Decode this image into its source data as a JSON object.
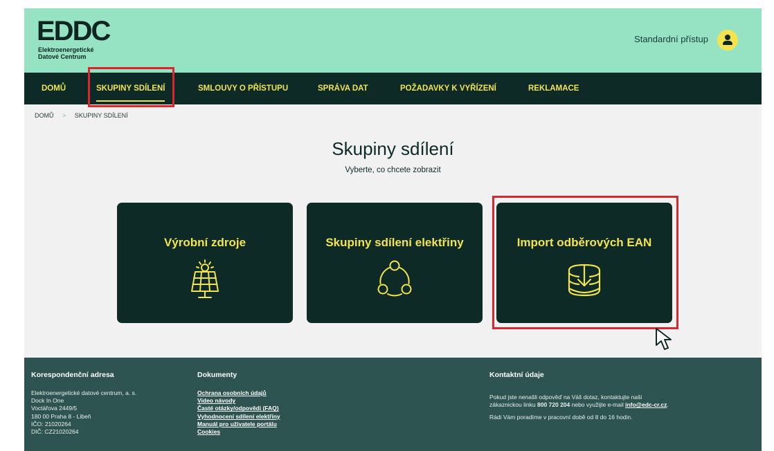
{
  "header": {
    "logo_mark": "EDDC",
    "logo_line1": "Elektroenergetické",
    "logo_line2": "Datové Centrum",
    "access_label": "Standardní přístup",
    "user_icon": "user-icon"
  },
  "nav": {
    "items": [
      {
        "label": "DOMŮ"
      },
      {
        "label": "SKUPINY SDÍLENÍ"
      },
      {
        "label": "SMLOUVY O PŘÍSTUPU"
      },
      {
        "label": "SPRÁVA DAT"
      },
      {
        "label": "POŽADAVKY K VYŘÍZENÍ"
      },
      {
        "label": "REKLAMACE"
      }
    ]
  },
  "breadcrumb": {
    "home": "DOMŮ",
    "separator": ">",
    "current": "SKUPINY SDÍLENÍ"
  },
  "page": {
    "title": "Skupiny sdílení",
    "subtitle": "Vyberte, co chcete zobrazit"
  },
  "cards": [
    {
      "title": "Výrobní zdroje",
      "icon": "solar-panel-icon"
    },
    {
      "title": "Skupiny sdílení elektřiny",
      "icon": "sharing-group-icon"
    },
    {
      "title": "Import odběrových EAN",
      "icon": "import-icon"
    }
  ],
  "footer": {
    "address": {
      "heading": "Korespondenční adresa",
      "lines": [
        "Elektroenergetické datové centrum, a. s.",
        "Dock In One",
        "Voctářova 2449/5",
        "180 00 Praha 8 - Libeň",
        "IČO: 21020264",
        "DIČ: CZ21020264"
      ]
    },
    "documents": {
      "heading": "Dokumenty",
      "links": [
        "Ochrana osobních údajů",
        "Video návody",
        "Časté otázky/odpovědi (FAQ)",
        "Vyhodnocení sdílení elektřiny",
        "Manuál pro uživatele portálu",
        "Cookies"
      ]
    },
    "contact": {
      "heading": "Kontaktní údaje",
      "line1": "Pokud jste nenašli odpověď na Váš dotaz, kontaktujte naši",
      "line2_pre": "zákaznickou linku ",
      "phone": "800 720 204",
      "line2_mid": " nebo využijte e-mail ",
      "email": "info@edc-cr.cz",
      "line2_post": ".",
      "line3": "Rádi Vám poradíme v pracovní době od 8 do 16 hodin."
    }
  },
  "colors": {
    "header_bg": "#96e3c3",
    "nav_bg": "#0d2a26",
    "accent": "#f3e44f",
    "highlight": "#e0242b",
    "footer_bg": "#2d5450"
  }
}
